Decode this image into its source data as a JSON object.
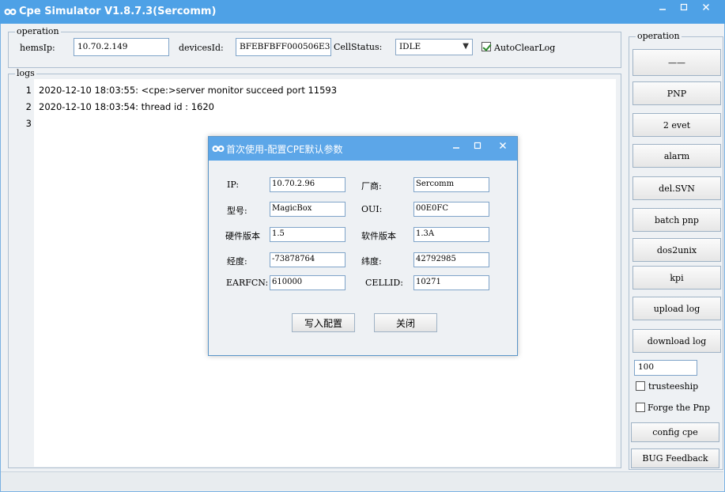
{
  "window": {
    "title": "Cpe Simulator V1.8.7.3(Sercomm)",
    "controls": [
      "minimize-icon",
      "restore-icon",
      "close-icon"
    ]
  },
  "operation": {
    "group_label": "operation",
    "hems_label": "hemsIp:",
    "hems_value": "10.70.2.149",
    "device_label": "devicesId:",
    "device_value": "BFEBFBFF000506E3",
    "cell_label": "CellStatus:",
    "cell_value": "IDLE",
    "autoclear_label": "AutoClearLog",
    "autoclear_checked": true
  },
  "logs": {
    "group_label": "logs",
    "lines": [
      {
        "num": "1",
        "text": "2020-12-10 18:03:55: <cpe:>server monitor succeed port 11593"
      },
      {
        "num": "2",
        "text": "2020-12-10 18:03:54: thread id : 1620"
      },
      {
        "num": "3",
        "text": ""
      }
    ]
  },
  "sidebar": {
    "group_label": "operation",
    "buttons": [
      "——",
      "PNP",
      "2 evet",
      "alarm",
      "del.SVN",
      "batch pnp",
      "dos2unix",
      "kpi",
      "upload log",
      "download log"
    ],
    "count_value": "100",
    "trusteeship_label": "trusteeship",
    "forge_label": "Forge the Pnp",
    "config_button": "config cpe",
    "bug_button": "BUG Feedback"
  },
  "dialog": {
    "title": "首次使用-配置CPE默认参数",
    "ip_label": "IP:",
    "ip_value": "10.70.2.96",
    "vendor_label": "厂商:",
    "vendor_value": "Sercomm",
    "model_label": "型号:",
    "model_value": "MagicBox",
    "oui_label": "OUI:",
    "oui_value": "00E0FC",
    "hw_label": "硬件版本",
    "hw_value": "1.5",
    "sw_label": "软件版本",
    "sw_value": "1.3A",
    "lon_label": "经度:",
    "lon_value": "-73878764",
    "lat_label": "纬度:",
    "lat_value": "42792985",
    "earfcn_label": "EARFCN:",
    "earfcn_value": "610000",
    "cellid_label": "CELLID:",
    "cellid_value": "10271",
    "write_button": "写入配置",
    "close_button": "关闭"
  }
}
